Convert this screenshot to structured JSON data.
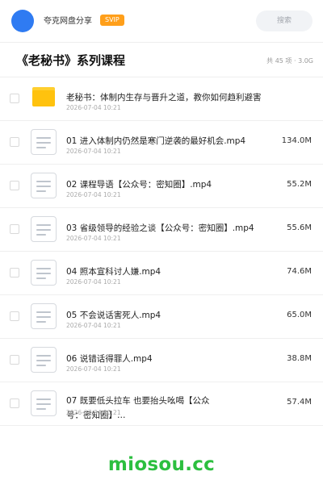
{
  "header": {
    "sharer": "夸克网盘分享",
    "badge": "SVIP",
    "search_placeholder": "搜索",
    "brand_color": "#2f7bf2",
    "badge_color": "#ff9f1a"
  },
  "folder": {
    "title": "《老秘书》系列课程",
    "meta": "共 45 项 · 3.0G"
  },
  "files": [
    {
      "type": "folder",
      "name": "老秘书：体制内生存与晋升之道，教你如何趋利避害",
      "date": "2026-07-04 10:21",
      "size": ""
    },
    {
      "type": "video",
      "name": "01 进入体制内仍然是寒门逆袭的最好机会.mp4",
      "date": "2026-07-04 10:21",
      "size": "134.0M"
    },
    {
      "type": "video",
      "name": "02 课程导语【公众号：密知圈】.mp4",
      "date": "2026-07-04 10:21",
      "size": "55.2M"
    },
    {
      "type": "video",
      "name": "03 省级领导的经验之谈【公众号：密知圈】.mp4",
      "date": "2026-07-04 10:21",
      "size": "55.6M"
    },
    {
      "type": "video",
      "name": "04 照本宣科讨人嫌.mp4",
      "date": "2026-07-04 10:21",
      "size": "74.6M"
    },
    {
      "type": "video",
      "name": "05 不会说话害死人.mp4",
      "date": "2026-07-04 10:21",
      "size": "65.0M"
    },
    {
      "type": "video",
      "name": "06 说错话得罪人.mp4",
      "date": "2026-07-04 10:21",
      "size": "38.8M"
    },
    {
      "type": "video",
      "name": "07 既要低头拉车 也要抬头吆喝【公众号：密知圈】…",
      "date": "2026-07-04 10:21",
      "size": "57.4M"
    }
  ],
  "watermark": "miosou.cc",
  "watermark_color": "#2cbf3f"
}
